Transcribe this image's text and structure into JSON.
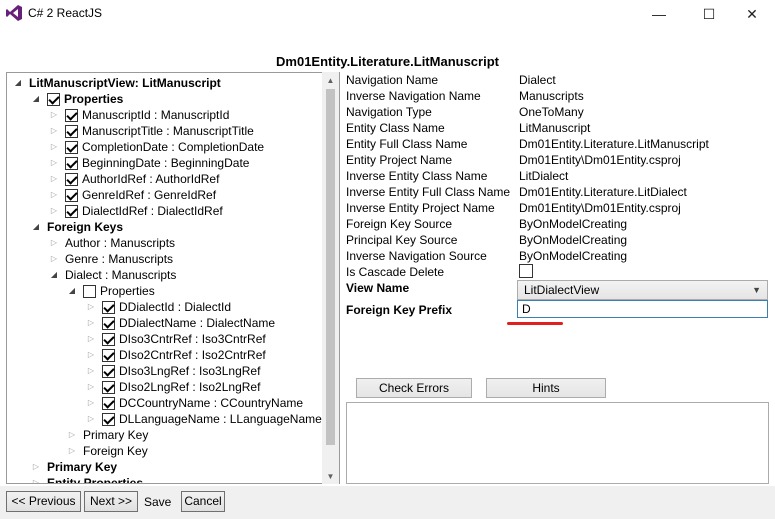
{
  "window": {
    "title": "C# 2 ReactJS",
    "minimize_glyph": "—",
    "maximize_glyph": "☐",
    "close_glyph": "✕"
  },
  "heading": "Dm01Entity.Literature.LitManuscript",
  "tree": {
    "root": "LitManuscriptView: LitManuscript",
    "properties_label": "Properties",
    "properties": [
      "ManuscriptId : ManuscriptId",
      "ManuscriptTitle : ManuscriptTitle",
      "CompletionDate : CompletionDate",
      "BeginningDate : BeginningDate",
      "AuthorIdRef : AuthorIdRef",
      "GenreIdRef : GenreIdRef",
      "DialectIdRef : DialectIdRef"
    ],
    "foreign_keys_label": "Foreign Keys",
    "fk_author": "Author : Manuscripts",
    "fk_genre": "Genre : Manuscripts",
    "fk_dialect": "Dialect : Manuscripts",
    "dialect_properties_label": "Properties",
    "dialect_properties": [
      "DDialectId : DialectId",
      "DDialectName : DialectName",
      "DIso3CntrRef : Iso3CntrRef",
      "DIso2CntrRef : Iso2CntrRef",
      "DIso3LngRef : Iso3LngRef",
      "DIso2LngRef : Iso2LngRef",
      "DCCountryName : CCountryName",
      "DLLanguageName : LLanguageName"
    ],
    "dialect_primary_key": "Primary Key",
    "dialect_foreign_key": "Foreign Key",
    "primary_key_label": "Primary Key",
    "entity_properties_label": "Entity Properties"
  },
  "details": [
    {
      "name": "Navigation Name",
      "value": "Dialect"
    },
    {
      "name": "Inverse Navigation Name",
      "value": "Manuscripts"
    },
    {
      "name": "Navigation Type",
      "value": "OneToMany"
    },
    {
      "name": "Entity Class Name",
      "value": "LitManuscript"
    },
    {
      "name": "Entity Full Class Name",
      "value": "Dm01Entity.Literature.LitManuscript"
    },
    {
      "name": "Entity Project Name",
      "value": "Dm01Entity\\Dm01Entity.csproj"
    },
    {
      "name": "Inverse Entity Class Name",
      "value": "LitDialect"
    },
    {
      "name": "Inverse Entity Full Class Name",
      "value": "Dm01Entity.Literature.LitDialect"
    },
    {
      "name": "Inverse Entity Project Name",
      "value": "Dm01Entity\\Dm01Entity.csproj"
    },
    {
      "name": "Foreign Key Source",
      "value": "ByOnModelCreating"
    },
    {
      "name": "Principal Key Source",
      "value": "ByOnModelCreating"
    },
    {
      "name": "Inverse Navigation Source",
      "value": "ByOnModelCreating"
    },
    {
      "name": "Is Cascade Delete",
      "value": ""
    }
  ],
  "view_name_label": "View Name",
  "view_name_value": "LitDialectView",
  "fk_prefix_label": "Foreign Key Prefix",
  "fk_prefix_value": "D",
  "buttons": {
    "check_errors": "Check Errors",
    "hints": "Hints"
  },
  "footer": {
    "previous": "<< Previous",
    "next": "Next >>",
    "save": "Save",
    "cancel": "Cancel"
  },
  "colors": {
    "accent": "#3c7fb1",
    "annotation": "#e02020",
    "app_icon": "#68217a"
  },
  "icons": [
    "visual-studio-icon",
    "minimize-icon",
    "maximize-icon",
    "close-icon"
  ]
}
